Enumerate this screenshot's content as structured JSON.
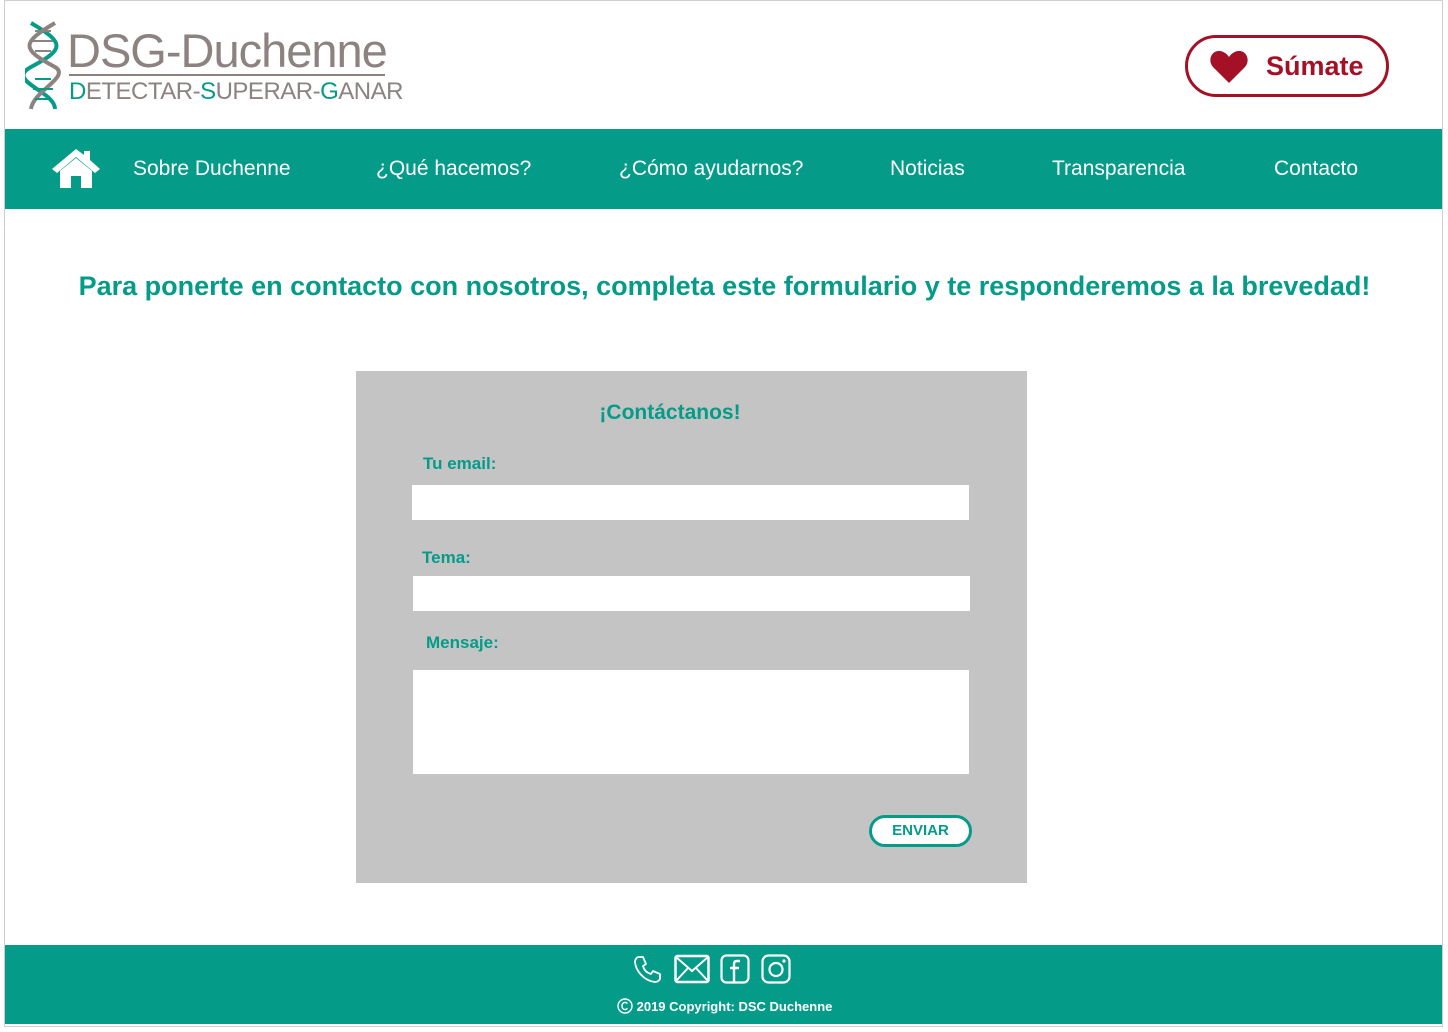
{
  "header": {
    "logo": {
      "name": "DSG-Duchenne",
      "tagline": {
        "d1": "D",
        "w1": "ETECTAR",
        "sep1": "-",
        "s1": "S",
        "w2": "UPERAR",
        "sep2": "-",
        "g1": "G",
        "w3": "ANAR"
      }
    },
    "join_button": {
      "label": "Súmate",
      "icon": "heart-icon"
    }
  },
  "nav": {
    "home_icon": "home-icon",
    "items": [
      {
        "label": "Sobre Duchenne"
      },
      {
        "label": "¿Qué hacemos?"
      },
      {
        "label": "¿Cómo ayudarnos?"
      },
      {
        "label": "Noticias"
      },
      {
        "label": "Transparencia"
      },
      {
        "label": "Contacto"
      }
    ]
  },
  "main": {
    "intro": "Para ponerte en contacto con nosotros, completa este formulario y te responderemos a la brevedad!"
  },
  "form": {
    "title": "¡Contáctanos!",
    "email_label": "Tu email:",
    "email_value": "",
    "subject_label": "Tema:",
    "subject_value": "",
    "message_label": "Mensaje:",
    "message_value": "",
    "submit_label": "ENVIAR"
  },
  "footer": {
    "icons": [
      "phone-icon",
      "email-icon",
      "facebook-icon",
      "instagram-icon"
    ],
    "copyright": "2019 Copyright: DSC Duchenne"
  },
  "colors": {
    "primary": "#059b89",
    "accent": "#a41126",
    "form_bg": "#c4c4c4",
    "logo_gray": "#8c8380"
  }
}
